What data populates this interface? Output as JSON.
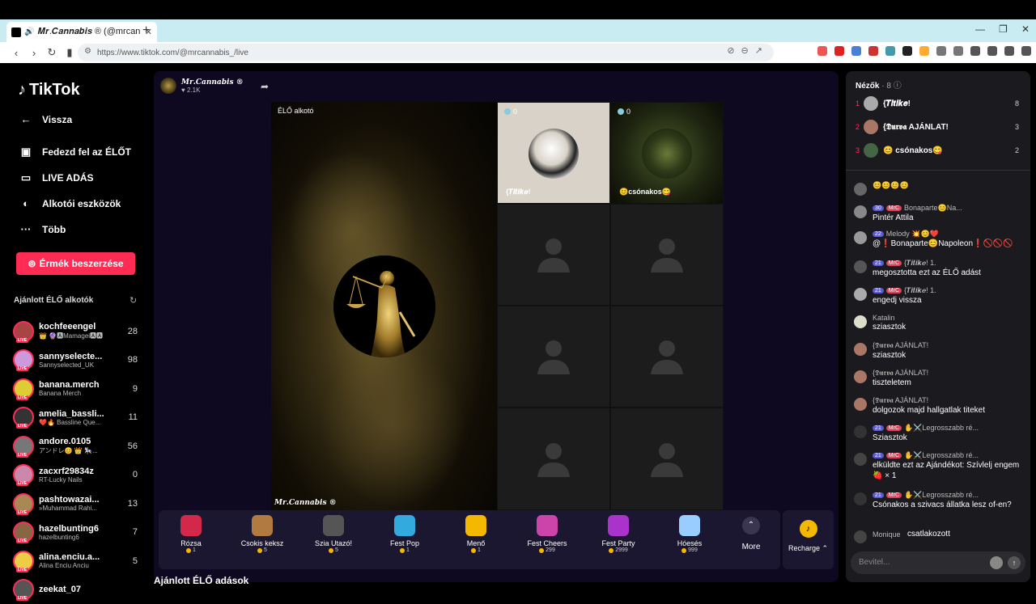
{
  "browser": {
    "tab_title": "𝑴𝒓.𝑪𝒂𝒏𝒏𝒂𝒃𝒊𝒔 ® (@mrcan",
    "url": "https://www.tiktok.com/@mrcannabis_/live"
  },
  "sidebar": {
    "logo": "TikTok",
    "nav": [
      {
        "label": "Vissza",
        "icon": "back-arrow-icon"
      },
      {
        "label": "Fedezd fel az ÉLŐT",
        "icon": "calendar-live-icon"
      },
      {
        "label": "LIVE ADÁS",
        "icon": "camera-icon"
      },
      {
        "label": "Alkotói eszközök",
        "icon": "lightbulb-icon"
      },
      {
        "label": "Több",
        "icon": "more-dots-icon"
      }
    ],
    "coins_button": "Érmék beszerzése",
    "recommended_title": "Ajánlott ÉLŐ alkotók",
    "recommended": [
      {
        "name": "kochfeeengel",
        "sub": "👑 🔮🅰Mamagei🅰🅰",
        "count": "28",
        "color": "#a44"
      },
      {
        "name": "sannyselecte...",
        "sub": "Sannyselected_UK",
        "count": "98",
        "color": "#c9d"
      },
      {
        "name": "banana.merch",
        "sub": "Banana Merch",
        "count": "9",
        "color": "#dc3"
      },
      {
        "name": "amelia_bassli...",
        "sub": "❤️🔥 Bassline Que...",
        "count": "11",
        "color": "#333"
      },
      {
        "name": "andore.0105",
        "sub": "アンドレ😊 👑 🎠...",
        "count": "56",
        "color": "#777"
      },
      {
        "name": "zacxrf29834z",
        "sub": "RT-Lucky Nails",
        "count": "0",
        "color": "#c8a"
      },
      {
        "name": "pashtowazai...",
        "sub": "»Muhammad Rahi...",
        "count": "13",
        "color": "#a85"
      },
      {
        "name": "hazelbunting6",
        "sub": "hazelbunting6",
        "count": "7",
        "color": "#864"
      },
      {
        "name": "alina.enciu.a...",
        "sub": "Alina Enciu Anciu",
        "count": "5",
        "color": "#ec4"
      },
      {
        "name": "zeekat_07",
        "sub": "",
        "count": "",
        "color": "#555"
      }
    ]
  },
  "stream": {
    "host_name": "𝑴𝒓.𝑪𝒂𝒏𝒏𝒂𝒃𝒊𝒔 ®",
    "host_likes": "♥ 2.1K",
    "creator_label": "ÉLŐ alkotó",
    "bottom_host": "𝑴𝒓.𝑪𝒂𝒏𝒏𝒂𝒃𝒊𝒔 ®",
    "guest1": {
      "count": "0",
      "name": "{𝑻𝒊𝒕𝒊𝒌𝒆!"
    },
    "guest2": {
      "count": "0",
      "name": "😊csónakos😋"
    }
  },
  "gifts": [
    {
      "name": "Rózsa",
      "price": "1",
      "color": "#d3284a"
    },
    {
      "name": "Csokis keksz",
      "price": "5",
      "color": "#b07a40"
    },
    {
      "name": "Szia Utazó!",
      "price": "5",
      "color": "#555"
    },
    {
      "name": "Fest Pop",
      "price": "1",
      "color": "#3ad"
    },
    {
      "name": "Menő",
      "price": "1",
      "color": "#f5b800"
    },
    {
      "name": "Fest Cheers",
      "price": "299",
      "color": "#c4a"
    },
    {
      "name": "Fest Party",
      "price": "2999",
      "color": "#a3c"
    },
    {
      "name": "Hóesés",
      "price": "999",
      "color": "#9cf"
    }
  ],
  "more_label": "More",
  "recharge_label": "Recharge ⌃",
  "suggest_title": "Ajánlott ÉLŐ adások",
  "chat": {
    "viewers_title": "Nézők",
    "viewers_count": "· 8",
    "viewers": [
      {
        "rank": "1",
        "name": "{𝑻𝒊𝒕𝒊𝒌𝒆!",
        "score": "8",
        "color": "#aaa"
      },
      {
        "rank": "2",
        "name": "{𝕯𝖚𝖗𝖛𝖆 AJÁNLAT!",
        "score": "3",
        "color": "#a76"
      },
      {
        "rank": "3",
        "name": "😊 csónakos😋",
        "score": "2",
        "color": "#464"
      }
    ],
    "input_placeholder": "Bevitel...",
    "messages": [
      {
        "head": "😊😊😊😊",
        "text": "",
        "lvl": "",
        "fan": "",
        "color": "#666"
      },
      {
        "head": "Bonaparte😊Na...",
        "text": "Pintér Attila",
        "lvl": "30",
        "fan": "MrC",
        "color": "#888"
      },
      {
        "head": "Melody 💥😊❤️",
        "text": "@❗Bonaparte😊Napoleon❗🚫🚫🚫",
        "lvl": "22",
        "fan": "",
        "color": "#999"
      },
      {
        "head": "{𝑻𝒊𝒕𝒊𝒌𝒆! 1.",
        "text": "megosztotta ezt az ÉLŐ adást",
        "lvl": "21",
        "fan": "MrC",
        "color": "#555"
      },
      {
        "head": "{𝑻𝒊𝒕𝒊𝒌𝒆! 1.",
        "text": "engedj vissza",
        "lvl": "21",
        "fan": "MrC",
        "color": "#aaa"
      },
      {
        "head": "Katalin",
        "text": "sziasztok",
        "lvl": "",
        "fan": "",
        "color": "#ddc"
      },
      {
        "head": "{𝕯𝖚𝖗𝖛𝖆 AJÁNLAT!",
        "text": "sziasztok",
        "lvl": "",
        "fan": "",
        "color": "#a76"
      },
      {
        "head": "{𝕯𝖚𝖗𝖛𝖆 AJÁNLAT!",
        "text": "tiszteletem",
        "lvl": "",
        "fan": "",
        "color": "#a76"
      },
      {
        "head": "{𝕯𝖚𝖗𝖛𝖆 AJÁNLAT!",
        "text": "dolgozok majd hallgatlak titeket",
        "lvl": "",
        "fan": "",
        "color": "#a76"
      },
      {
        "head": "✋⚔️Legrosszabb ré...",
        "text": "Sziasztok",
        "lvl": "21",
        "fan": "MrC",
        "color": "#333"
      },
      {
        "head": "✋⚔️Legrosszabb ré...",
        "text": "elküldte ezt az Ajándékot:  Szívlelj engem 🍓 × 1",
        "lvl": "21",
        "fan": "MrC",
        "color": "#444"
      },
      {
        "head": "✋⚔️Legrosszabb ré...",
        "text": "Csónakos a szivacs állatka lesz of-en?",
        "lvl": "21",
        "fan": "MrC",
        "color": "#333"
      },
      {
        "head": "Monique",
        "text": "csatlakozott",
        "lvl": "",
        "fan": "",
        "color": "#444"
      }
    ]
  }
}
